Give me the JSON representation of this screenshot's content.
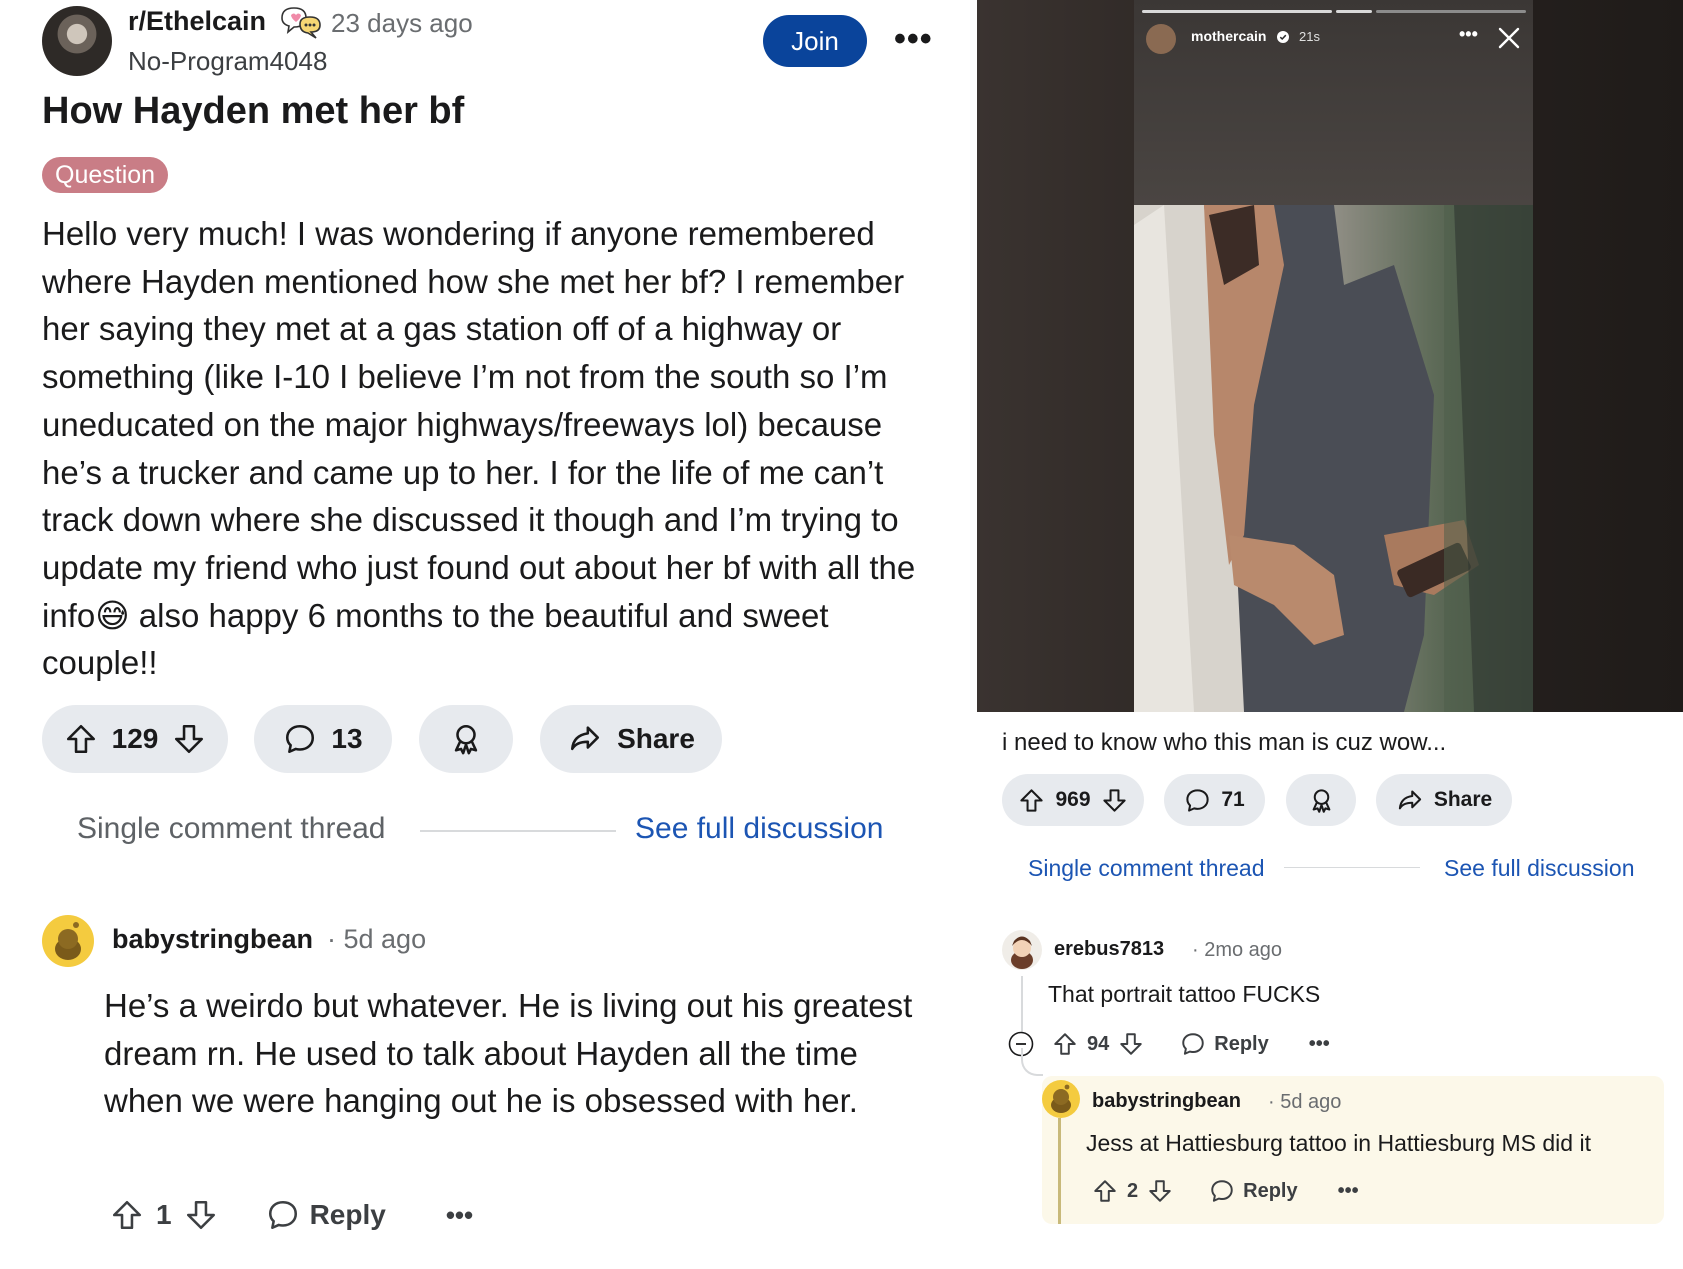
{
  "left_post": {
    "subreddit": "r/Ethelcain",
    "time": "23 days ago",
    "username": "No-Program4048",
    "join_label": "Join",
    "more_label": "•••",
    "title": "How Hayden met her bf",
    "flair": "Question",
    "body": "Hello very much! I was wondering if anyone remembered where Hayden mentioned how she met her bf? I remember her saying they met at a gas station off of a highway or something (like I-10 I believe I’m not from the south so I’m uneducated on the major highways/freeways lol) because he’s a trucker and came up to her. I for the life of me can’t track down where she discussed it though and I’m trying to update my friend who just found out about her bf with all the info😅 also happy 6 months to the beautiful and sweet couple!!",
    "votes": "129",
    "comments": "13",
    "share_label": "Share",
    "thread_label": "Single comment thread",
    "full_discussion": "See full discussion",
    "comment": {
      "user": "babystringbean",
      "time": "5d ago",
      "body": "He’s a weirdo but whatever. He is living out his greatest dream rn. He used to talk about Hayden all the time when we were hanging out he is obsessed with her.",
      "votes": "1",
      "reply_label": "Reply",
      "more_label": "•••"
    }
  },
  "right_post": {
    "story_user": "mothercain",
    "story_time": "21s",
    "story_more": "•••",
    "caption": "i need to know who this man is cuz wow...",
    "votes": "969",
    "comments": "71",
    "share_label": "Share",
    "thread_label": "Single comment thread",
    "full_discussion": "See full discussion",
    "comment1": {
      "user": "erebus7813",
      "time": "2mo ago",
      "body": "That portrait tattoo FUCKS",
      "votes": "94",
      "reply_label": "Reply",
      "more_label": "•••"
    },
    "comment2": {
      "user": "babystringbean",
      "time": "5d ago",
      "body": "Jess at Hattiesburg tattoo in Hattiesburg MS did it",
      "votes": "2",
      "reply_label": "Reply",
      "more_label": "•••"
    }
  },
  "colors": {
    "join_bg": "#0a449b",
    "flair_bg": "#c97d86",
    "link_blue": "#1c55b3",
    "pill_bg": "#e7eaee",
    "snoo_yellow": "#f4cb3f",
    "reply_highlight": "#fcf8e9"
  },
  "icons": [
    "upvote-icon",
    "downvote-icon",
    "comment-icon",
    "award-icon",
    "share-icon",
    "collapse-icon",
    "close-icon",
    "verified-icon"
  ]
}
